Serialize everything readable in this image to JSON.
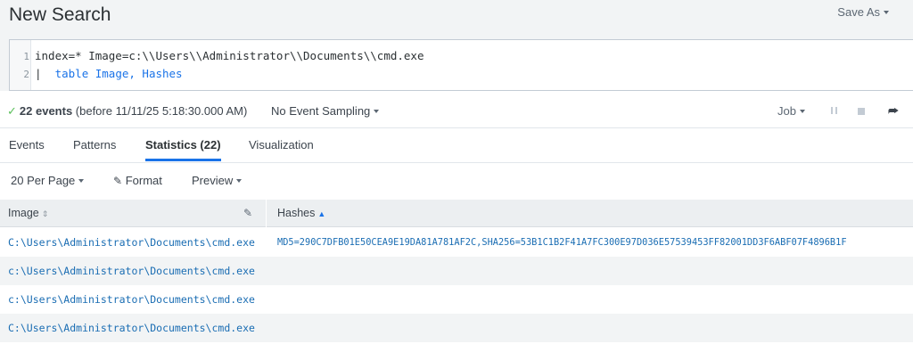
{
  "header": {
    "title": "New Search",
    "save_as": "Save As"
  },
  "search": {
    "lines": [
      "index=* Image=c:\\\\Users\\\\Administrator\\\\Documents\\\\cmd.exe",
      "table Image, Hashes"
    ],
    "pipe": "|",
    "line_numbers": [
      "1",
      "2"
    ]
  },
  "status": {
    "check": "✓",
    "count": "22 events",
    "detail": " (before 11/11/25 5:18:30.000 AM)",
    "sampling": "No Event Sampling",
    "job": "Job"
  },
  "tabs": [
    "Events",
    "Patterns",
    "Statistics (22)",
    "Visualization"
  ],
  "toolbar": {
    "per_page": "20 Per Page",
    "format": "Format",
    "preview": "Preview"
  },
  "table": {
    "columns": [
      "Image",
      "Hashes"
    ],
    "rows": [
      {
        "image": "C:\\Users\\Administrator\\Documents\\cmd.exe",
        "hashes": "MD5=290C7DFB01E50CEA9E19DA81A781AF2C,SHA256=53B1C1B2F41A7FC300E97D036E57539453FF82001DD3F6ABF07F4896B1F"
      },
      {
        "image": "c:\\Users\\Administrator\\Documents\\cmd.exe",
        "hashes": ""
      },
      {
        "image": "c:\\Users\\Administrator\\Documents\\cmd.exe",
        "hashes": ""
      },
      {
        "image": "C:\\Users\\Administrator\\Documents\\cmd.exe",
        "hashes": ""
      }
    ]
  },
  "icons": {
    "check": "check-icon",
    "pause": "pause-icon",
    "stop": "stop-icon",
    "share": "share-icon",
    "pencil": "pencil-icon",
    "sort": "sort-icon",
    "sort_asc": "sort-asc-icon"
  },
  "colors": {
    "accent": "#1a73e8",
    "link": "#1a6db3",
    "success": "#5cc05c"
  }
}
